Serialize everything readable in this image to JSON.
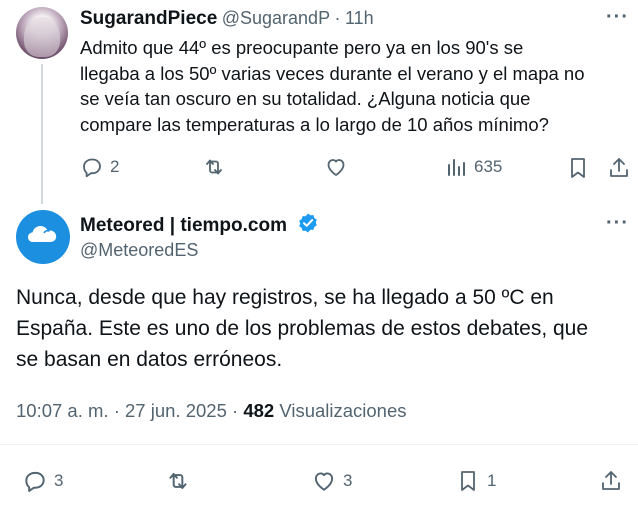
{
  "reply": {
    "name": "SugarandPiece",
    "handle": "@SugarandP",
    "separator": "·",
    "time": "11h",
    "text_lines": [
      "Admito que 44º es preocupante pero ya en los 90's se",
      "llegaba a los 50º varias veces durante el verano y el mapa no",
      "se veía tan oscuro en su totalidad. ¿Alguna noticia que",
      "compare las temperaturas a lo largo de 10 años mínimo?"
    ],
    "replies": "2",
    "views": "635"
  },
  "main": {
    "name": "Meteored | tiempo.com",
    "handle": "@MeteoredES",
    "text_lines": [
      "Nunca, desde que hay registros, se ha llegado a 50 ºC en",
      "España. Este es uno de los problemas de estos debates, que",
      "se basan en datos erróneos."
    ],
    "time": "10:07 a. m.",
    "sep1": "·",
    "date": "27 jun. 2025",
    "sep2": "·",
    "views": "482",
    "views_label": "Visualizaciones",
    "replies": "3",
    "likes": "3",
    "bookmarks": "1"
  },
  "colors": {
    "text": "#0f1419",
    "muted": "#536471",
    "verified": "#1d9bf0",
    "meteored_blue": "#1d8fe0"
  }
}
